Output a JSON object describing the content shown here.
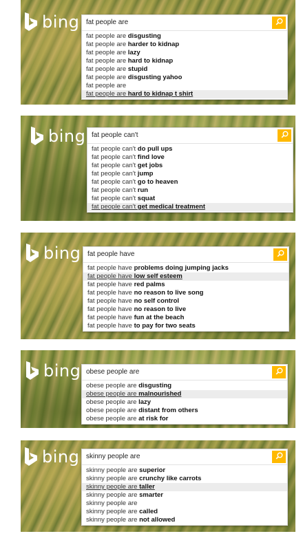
{
  "brand": {
    "word": "bing"
  },
  "colors": {
    "accent": "#ffb900",
    "logo": "#ffffff",
    "highlight": "#ececec"
  },
  "icons": {
    "logo": "bing-b-icon",
    "search": "search-icon"
  },
  "panels": [
    {
      "query": "fat people are",
      "suggestions": [
        {
          "prefix": "fat people are ",
          "completion": "disgusting"
        },
        {
          "prefix": "fat people are ",
          "completion": "harder to kidnap"
        },
        {
          "prefix": "fat people are ",
          "completion": "lazy"
        },
        {
          "prefix": "fat people are ",
          "completion": "hard to kidnap"
        },
        {
          "prefix": "fat people are ",
          "completion": "stupid"
        },
        {
          "prefix": "fat people are ",
          "completion": "disgusting yahoo"
        },
        {
          "prefix": "fat people are",
          "completion": ""
        },
        {
          "prefix": "fat people are ",
          "completion": "hard to kidnap t shirt"
        }
      ]
    },
    {
      "query": "fat people can't",
      "suggestions": [
        {
          "prefix": "fat people can't ",
          "completion": "do pull ups"
        },
        {
          "prefix": "fat people can't ",
          "completion": "find love"
        },
        {
          "prefix": "fat people can't ",
          "completion": "get jobs"
        },
        {
          "prefix": "fat people can't ",
          "completion": "jump"
        },
        {
          "prefix": "fat people can't ",
          "completion": "go to heaven"
        },
        {
          "prefix": "fat people can't ",
          "completion": "run"
        },
        {
          "prefix": "fat people can't ",
          "completion": "squat"
        },
        {
          "prefix": "fat people can't ",
          "completion": "get medical treatment"
        }
      ]
    },
    {
      "query": "fat people have",
      "suggestions": [
        {
          "prefix": "fat people have ",
          "completion": "problems doing jumping jacks"
        },
        {
          "prefix": "fat people have ",
          "completion": "low self esteem"
        },
        {
          "prefix": "fat people have ",
          "completion": "red palms"
        },
        {
          "prefix": "fat people have ",
          "completion": "no reason to live song"
        },
        {
          "prefix": "fat people have ",
          "completion": "no self control"
        },
        {
          "prefix": "fat people have ",
          "completion": "no reason to live"
        },
        {
          "prefix": "fat people have ",
          "completion": "fun at the beach"
        },
        {
          "prefix": "fat people have ",
          "completion": "to pay for two seats"
        }
      ]
    },
    {
      "query": "obese people are",
      "suggestions": [
        {
          "prefix": "obese people are ",
          "completion": "disgusting"
        },
        {
          "prefix": "obese people are ",
          "completion": "malnourished"
        },
        {
          "prefix": "obese people are ",
          "completion": "lazy"
        },
        {
          "prefix": "obese people are ",
          "completion": "distant from others"
        },
        {
          "prefix": "obese people are ",
          "completion": "at risk for"
        }
      ]
    },
    {
      "query": "skinny people are",
      "suggestions": [
        {
          "prefix": "skinny people are ",
          "completion": "superior"
        },
        {
          "prefix": "skinny people are ",
          "completion": "crunchy like carrots"
        },
        {
          "prefix": "skinny people are ",
          "completion": "taller"
        },
        {
          "prefix": "skinny people are ",
          "completion": "smarter"
        },
        {
          "prefix": "skinny people are",
          "completion": ""
        },
        {
          "prefix": "skinny people are ",
          "completion": "called"
        },
        {
          "prefix": "skinny people are ",
          "completion": "not allowed"
        }
      ]
    }
  ]
}
